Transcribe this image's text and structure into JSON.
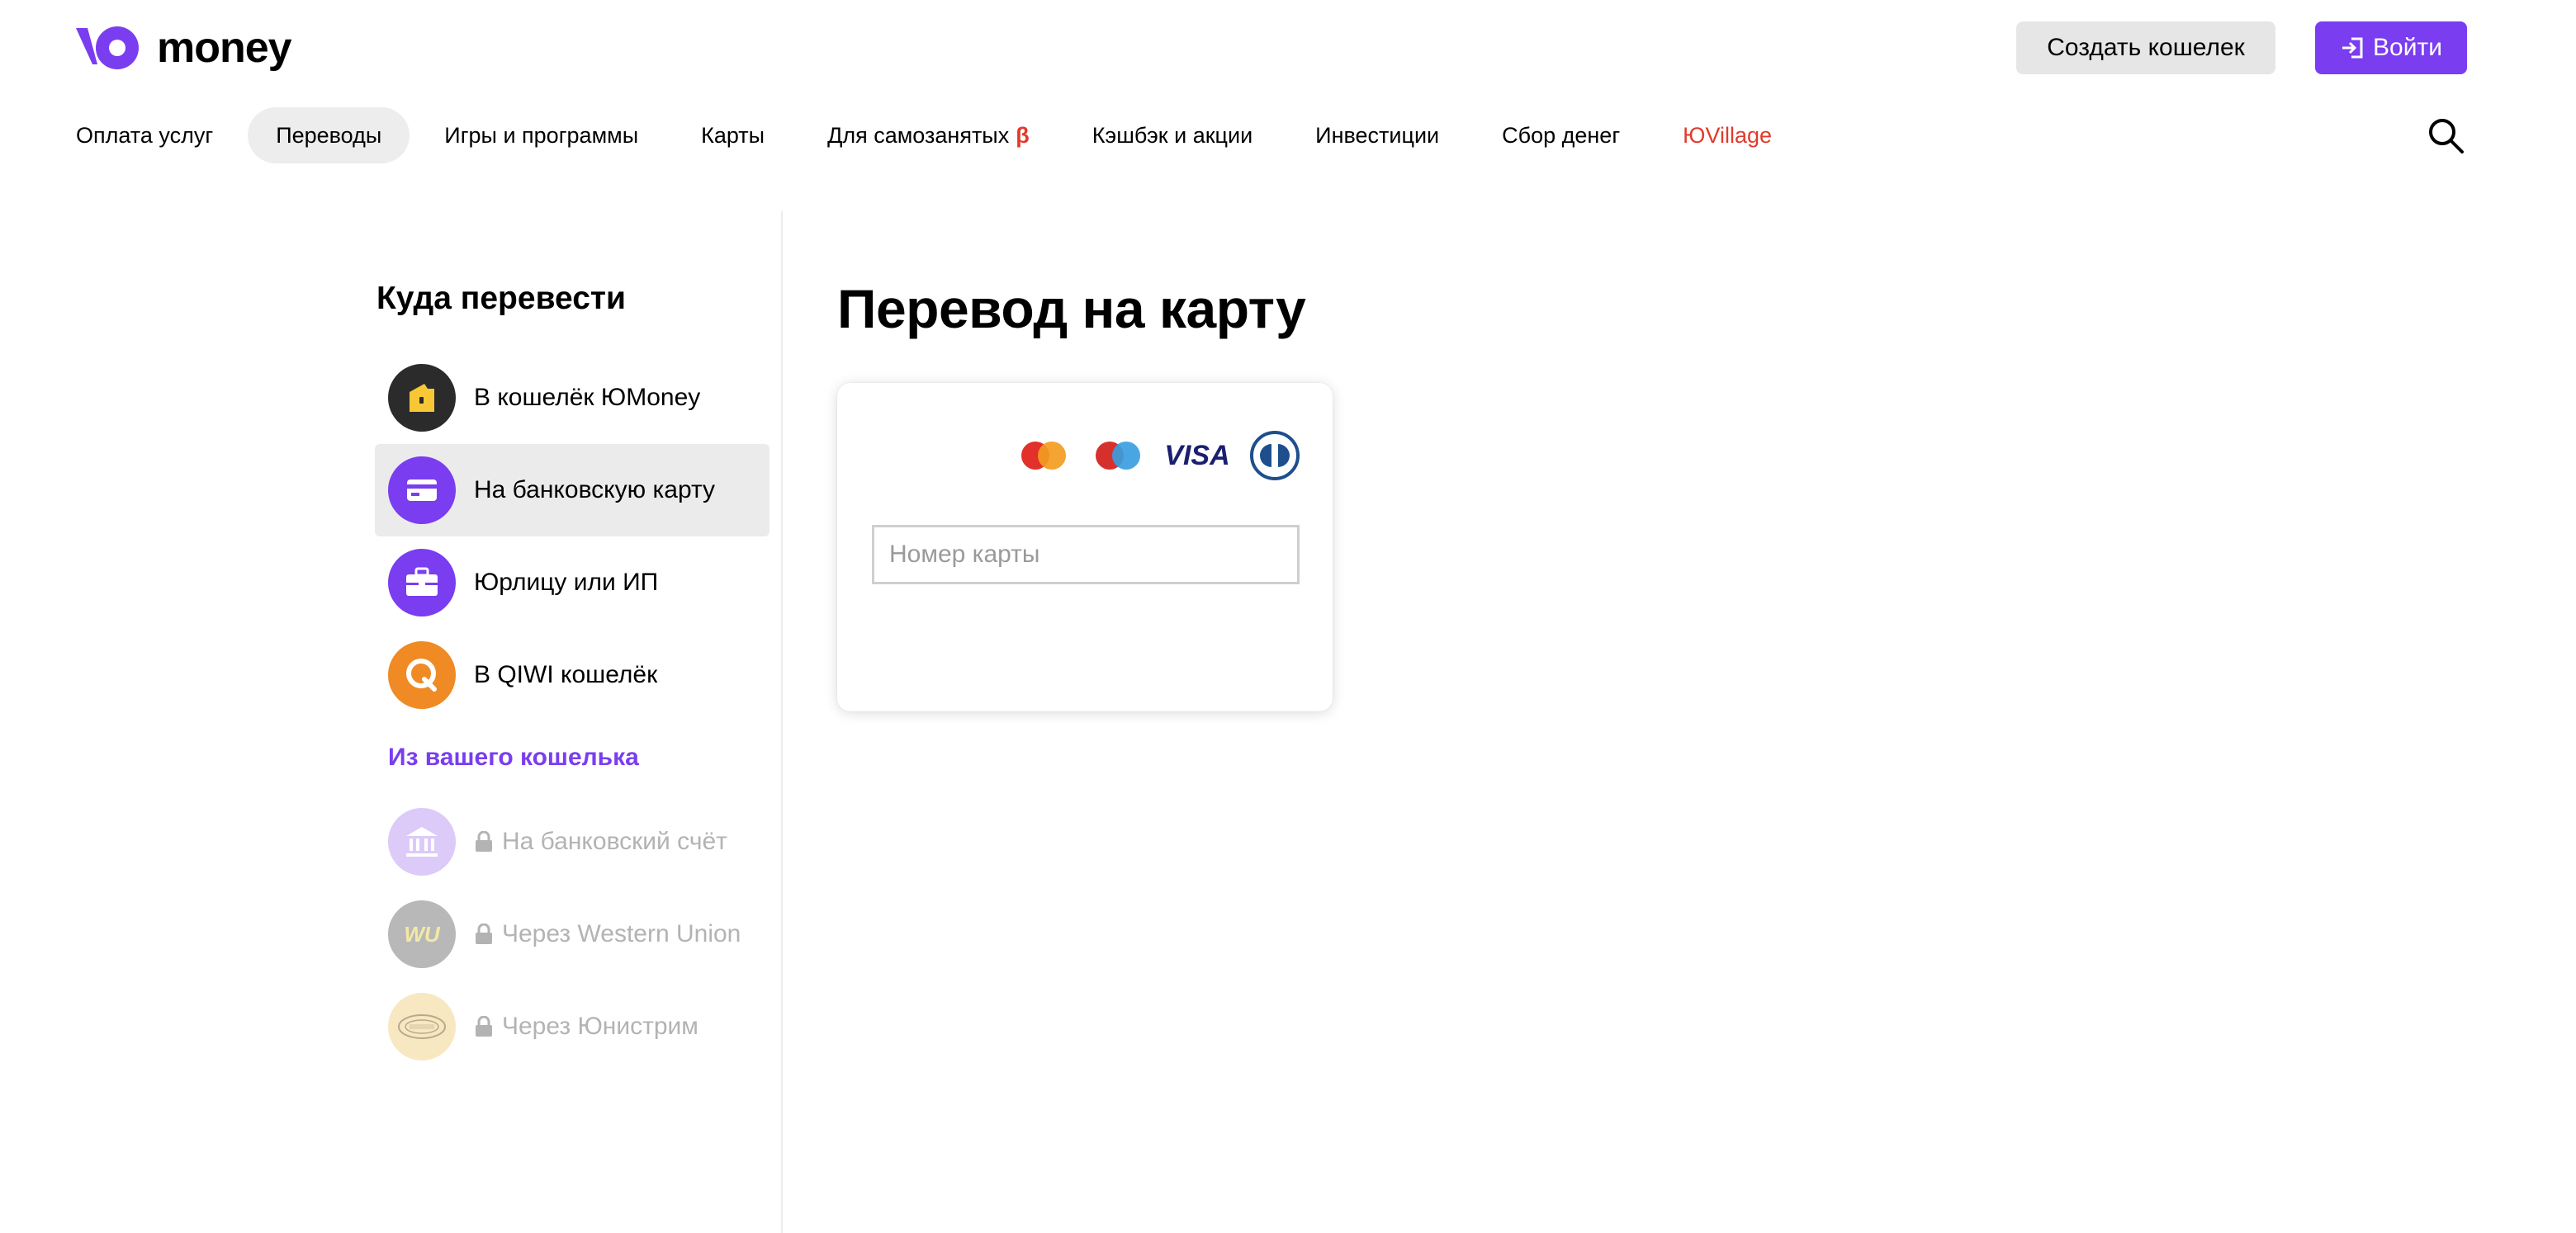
{
  "header": {
    "logo_text": "money",
    "create_wallet_label": "Создать кошелек",
    "login_label": "Войти",
    "accent_color": "#7a3df0"
  },
  "topnav": {
    "items": [
      {
        "label": "Оплата услуг"
      },
      {
        "label": "Переводы",
        "active": true
      },
      {
        "label": "Игры и программы"
      },
      {
        "label": "Карты"
      },
      {
        "label": "Для самозанятых",
        "badge": "β"
      },
      {
        "label": "Кэшбэк и акции"
      },
      {
        "label": "Инвестиции"
      },
      {
        "label": "Сбор денег"
      },
      {
        "label": "ЮVillage",
        "accent": "#e23a2b"
      }
    ],
    "search_icon": "search-icon"
  },
  "sidebar": {
    "title": "Куда перевести",
    "items": [
      {
        "label": "В кошелёк ЮMoney",
        "icon": "wallet-icon"
      },
      {
        "label": "На банковскую карту",
        "icon": "card-icon",
        "active": true
      },
      {
        "label": "Юрлицу или ИП",
        "icon": "briefcase-icon"
      },
      {
        "label": "В QIWI кошелёк",
        "icon": "qiwi-icon"
      }
    ],
    "subtitle": "Из вашего кошелька",
    "locked_items": [
      {
        "label": "На банковский счёт",
        "icon": "bank-icon"
      },
      {
        "label": "Через Western Union",
        "icon": "western-union-icon",
        "icon_text": "WU"
      },
      {
        "label": "Через Юнистрим",
        "icon": "unistream-icon"
      }
    ]
  },
  "main": {
    "title": "Перевод на карту",
    "card_form": {
      "brands": [
        "mastercard",
        "maestro",
        "VISA",
        "diners-club"
      ],
      "card_number_placeholder": "Номер карты",
      "card_number_value": ""
    }
  }
}
